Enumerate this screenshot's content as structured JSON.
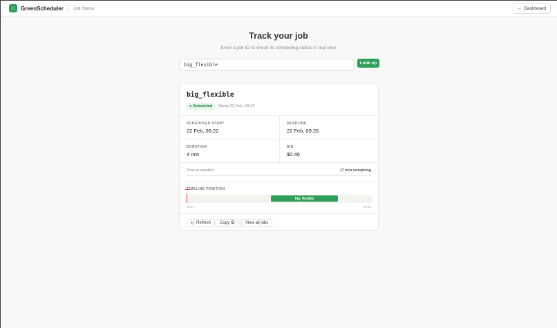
{
  "header": {
    "brand": "GreenScheduler",
    "breadcrumb": "Job Status",
    "dashboard_label": "Dashboard",
    "dashboard_icon": "arrow-left-icon"
  },
  "hero": {
    "title": "Track your job",
    "subtitle": "Enter a job ID to check its scheduling status in real time"
  },
  "search": {
    "value": "big_flexible",
    "button_label": "Look up"
  },
  "job": {
    "name": "big_flexible",
    "status": "Scheduled",
    "status_color": "#1f7a40",
    "starts_text": "Starts 22 Feb, 09:22",
    "scheduled_start_label": "SCHEDULED START",
    "scheduled_start": "22 Feb, 09:22",
    "deadline_label": "DEADLINE",
    "deadline": "22 Feb, 09:26",
    "duration_label": "DURATION",
    "duration": "4 min",
    "bid_label": "BID",
    "bid": "$0.40",
    "time_to_deadline_label": "Time to deadline",
    "time_remaining": "17 min remaining",
    "timeline_label": "TIMELINE POSITION",
    "timeline_bar_label": "big_flexible",
    "timeline_start": "09:17",
    "timeline_end": "09:28"
  },
  "actions": {
    "refresh": "Refresh",
    "copy_id": "Copy ID",
    "view_all": "View all jobs"
  },
  "colors": {
    "accent": "#2f9e57",
    "now_marker": "#dd3333"
  }
}
